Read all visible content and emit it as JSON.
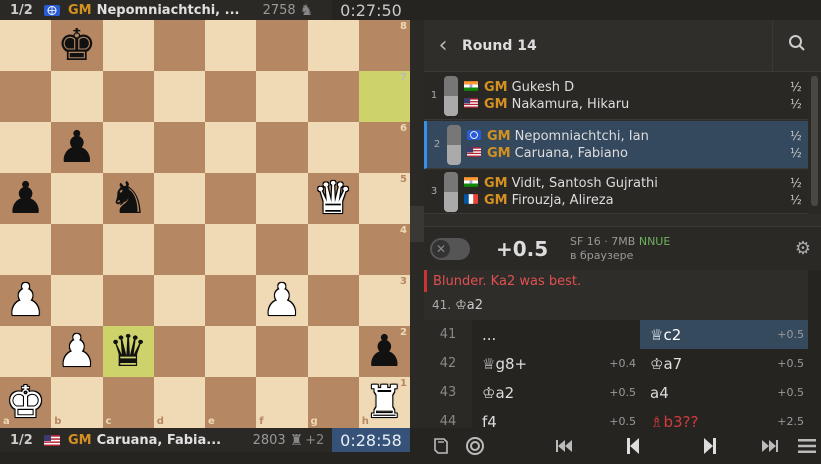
{
  "top_player": {
    "result": "1/2",
    "title": "GM",
    "name": "Nepomniachtchi, ...",
    "rating": "2758",
    "piece_icon": "♞",
    "clock": "0:27:50",
    "flag": "FIDE"
  },
  "bottom_player": {
    "result": "1/2",
    "title": "GM",
    "name": "Caruana, Fabia...",
    "rating": "2803",
    "piece_icon": "♜",
    "diff": "+2",
    "clock": "0:28:58",
    "flag": "USA"
  },
  "board": {
    "ranks": [
      "8",
      "7",
      "6",
      "5",
      "4",
      "3",
      "2",
      "1"
    ],
    "files": [
      "a",
      "b",
      "c",
      "d",
      "e",
      "f",
      "g",
      "h"
    ],
    "position": [
      [
        "",
        "bk",
        "",
        "",
        "",
        "",
        "",
        ""
      ],
      [
        "",
        "",
        "",
        "",
        "",
        "",
        "",
        ""
      ],
      [
        "",
        "bp",
        "",
        "",
        "",
        "",
        "",
        ""
      ],
      [
        "bp",
        "",
        "bn",
        "",
        "",
        "",
        "wq",
        ""
      ],
      [
        "",
        "",
        "",
        "",
        "",
        "",
        "",
        ""
      ],
      [
        "wp",
        "",
        "",
        "",
        "",
        "wp",
        "",
        ""
      ],
      [
        "",
        "wp",
        "bq",
        "",
        "",
        "",
        "",
        "bp"
      ],
      [
        "wk",
        "",
        "",
        "",
        "",
        "",
        "",
        "wr"
      ]
    ],
    "highlights": [
      "h7",
      "c2"
    ]
  },
  "broadcast": {
    "round_title": "Round 14",
    "back_icon": "chevron-left-icon",
    "search_icon": "search-icon",
    "games": [
      {
        "num": "1",
        "white": {
          "title": "GM",
          "name": "Gukesh D",
          "flag": "IND",
          "score": "½"
        },
        "black": {
          "title": "GM",
          "name": "Nakamura, Hikaru",
          "flag": "USA",
          "score": "½"
        },
        "active": false
      },
      {
        "num": "2",
        "white": {
          "title": "GM",
          "name": "Nepomniachtchi, Ian",
          "flag": "FIDE",
          "score": "½"
        },
        "black": {
          "title": "GM",
          "name": "Caruana, Fabiano",
          "flag": "USA",
          "score": "½"
        },
        "active": true
      },
      {
        "num": "3",
        "white": {
          "title": "GM",
          "name": "Vidit, Santosh Gujrathi",
          "flag": "IND",
          "score": "½"
        },
        "black": {
          "title": "GM",
          "name": "Firouzja, Alireza",
          "flag": "FRA",
          "score": "½"
        },
        "active": false
      }
    ]
  },
  "engine": {
    "eval": "+0.5",
    "name": "SF 16 · 7MB",
    "nnue": "NNUE",
    "location": "в браузере",
    "blunder_text": "Blunder. Ka2 was best.",
    "best_line_num": "41.",
    "best_line_move": "♔a2"
  },
  "moves": [
    {
      "n": "41",
      "w": "...",
      "w_eval": "",
      "b": "♕c2",
      "b_eval": "+0.5"
    },
    {
      "n": "42",
      "w": "♕g8+",
      "w_eval": "+0.4",
      "b": "♔a7",
      "b_eval": "+0.5"
    },
    {
      "n": "43",
      "w": "♔a2",
      "w_eval": "+0.5",
      "b": "a4",
      "b_eval": "+0.5"
    },
    {
      "n": "44",
      "w": "f4",
      "w_eval": "+0.5",
      "b": "♗b3??",
      "b_eval": "+2.5"
    }
  ],
  "colors": {
    "accent": "#3692e7",
    "title_gold": "#d59120",
    "blunder_red": "#d23b3b",
    "clock_active": "#375278"
  }
}
